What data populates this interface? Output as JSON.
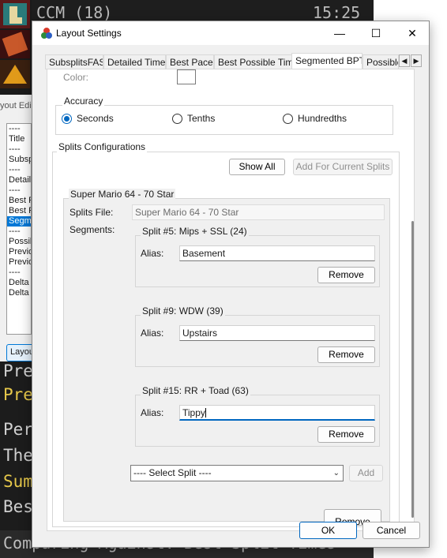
{
  "background_app": {
    "title": "CCM (18)",
    "time": "15:25",
    "editor_label": "yout Edi",
    "list_items": [
      "----",
      "Title",
      "----",
      "Subsp",
      "----",
      "Detail",
      "----",
      "Best P",
      "Best P",
      "Segme",
      "----",
      "Possib",
      "Previo",
      "Previo",
      "----",
      "Delta",
      "Delta"
    ],
    "layout_button": "Layou",
    "lines": [
      "Pre",
      "Pre",
      "Per",
      "The",
      "Sum",
      "Bes"
    ],
    "footer": "Comparing Against: Best Split Times"
  },
  "window": {
    "title": "Layout Settings",
    "minimize": "—",
    "maximize": "☐",
    "close": "✕"
  },
  "tabs": [
    "SubsplitsFAS",
    "Detailed Timer",
    "Best Pace",
    "Best Possible Time",
    "Segmented BPT",
    "Possible"
  ],
  "active_tab": "Segmented BPT",
  "tab_scroll": {
    "left": "◀",
    "right": "▶"
  },
  "color": {
    "label": "Color:",
    "value": "#FFFFFF"
  },
  "accuracy": {
    "legend": "Accuracy",
    "options": [
      "Seconds",
      "Tenths",
      "Hundredths"
    ],
    "selected": "Seconds"
  },
  "splits_config": {
    "legend": "Splits Configurations",
    "show_all": "Show All",
    "add_for_current": "Add For Current Splits",
    "game": {
      "legend": "Super Mario 64 - 70 Star",
      "splits_file_label": "Splits File:",
      "splits_file_value": "Super Mario 64 - 70 Star",
      "segments_label": "Segments:",
      "segments": [
        {
          "title": "Split #5: Mips + SSL (24)",
          "alias_label": "Alias:",
          "alias": "Basement",
          "remove": "Remove"
        },
        {
          "title": "Split #9: WDW (39)",
          "alias_label": "Alias:",
          "alias": "Upstairs",
          "remove": "Remove"
        },
        {
          "title": "Split #15: RR + Toad (63)",
          "alias_label": "Alias:",
          "alias": "Tippy",
          "remove": "Remove"
        }
      ],
      "select_split": "---- Select Split ----",
      "add": "Add",
      "remove_partial": "Remove"
    }
  },
  "footer_buttons": {
    "ok": "OK",
    "cancel": "Cancel"
  }
}
